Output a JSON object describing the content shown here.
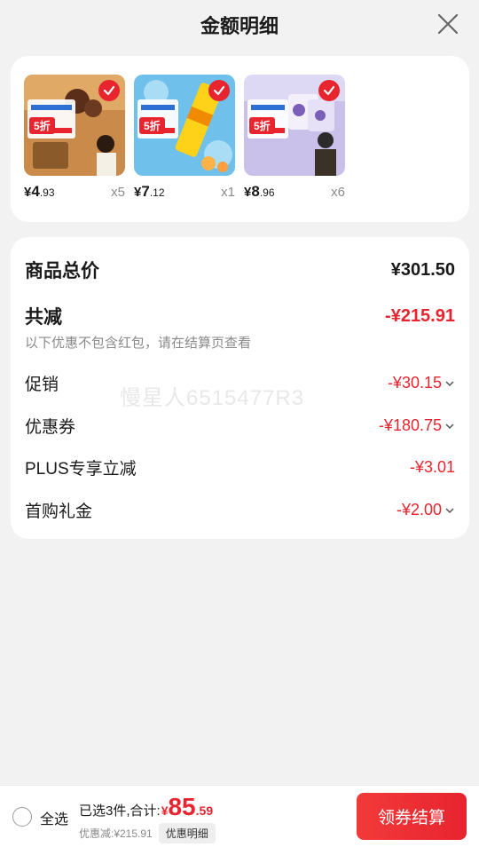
{
  "header": {
    "title": "金额明细"
  },
  "products": [
    {
      "price_symbol": "¥",
      "price_int": "4",
      "price_dec": ".93",
      "qty": "x5",
      "badge": "5折",
      "theme": "chocolate"
    },
    {
      "price_symbol": "¥",
      "price_int": "7",
      "price_dec": ".12",
      "qty": "x1",
      "badge": "5折",
      "theme": "popsicle"
    },
    {
      "price_symbol": "¥",
      "price_int": "8",
      "price_dec": ".96",
      "qty": "x6",
      "badge": "5折",
      "theme": "tub"
    }
  ],
  "summary": {
    "goods_total_label": "商品总价",
    "goods_total_value": "¥301.50",
    "total_discount_label": "共减",
    "total_discount_value": "-¥215.91",
    "note": "以下优惠不包含红包，请在结算页查看",
    "items": [
      {
        "label": "促销",
        "value": "-¥30.15",
        "expandable": true
      },
      {
        "label": "优惠券",
        "value": "-¥180.75",
        "expandable": true
      },
      {
        "label": "PLUS专享立减",
        "value": "-¥3.01",
        "expandable": false
      },
      {
        "label": "首购礼金",
        "value": "-¥2.00",
        "expandable": true
      }
    ]
  },
  "watermark": "慢星人6515477R3",
  "bottom_bar": {
    "select_all_label": "全选",
    "selected_text": "已选3件,合计:",
    "total_symbol": "¥",
    "total_int": "85",
    "total_dec": ".59",
    "discount_text": "优惠减:¥215.91",
    "detail_button": "优惠明细",
    "checkout_button": "领券结算"
  },
  "colors": {
    "accent": "#e8242f",
    "background": "#f2f2f2"
  },
  "icons": {
    "close": "close-icon",
    "check": "check-icon",
    "chevron": "chevron-down-icon"
  }
}
